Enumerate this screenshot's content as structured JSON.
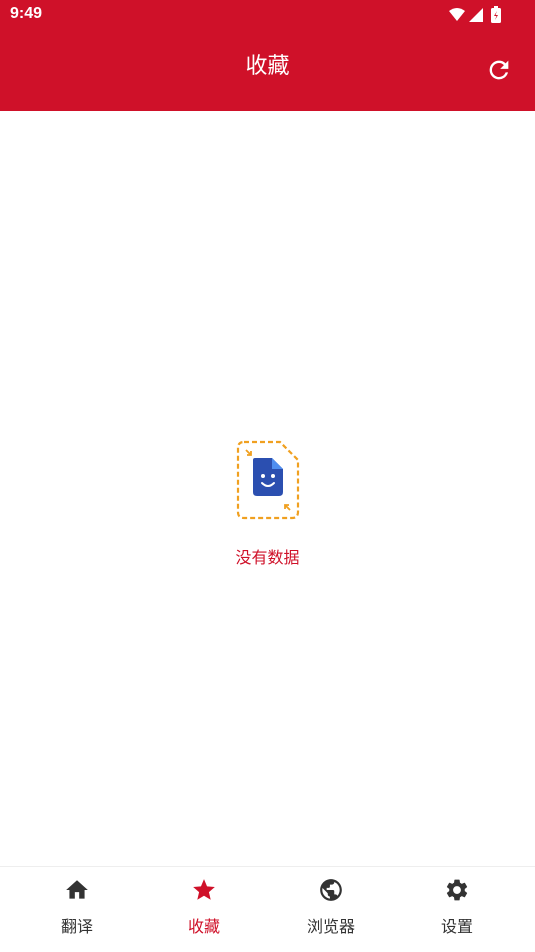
{
  "status_bar": {
    "time": "9:49"
  },
  "header": {
    "title": "收藏",
    "refresh_icon": "refresh-icon"
  },
  "empty_state": {
    "icon": "empty-file-icon",
    "message": "没有数据"
  },
  "bottom_nav": {
    "items": [
      {
        "label": "翻译",
        "icon": "home-icon",
        "active": false
      },
      {
        "label": "收藏",
        "icon": "star-icon",
        "active": true
      },
      {
        "label": "浏览器",
        "icon": "globe-icon",
        "active": false
      },
      {
        "label": "设置",
        "icon": "gear-icon",
        "active": false
      }
    ]
  },
  "colors": {
    "accent": "#cf1129",
    "empty_icon_dash": "#f0a020",
    "empty_icon_doc": "#2b4fb0"
  }
}
